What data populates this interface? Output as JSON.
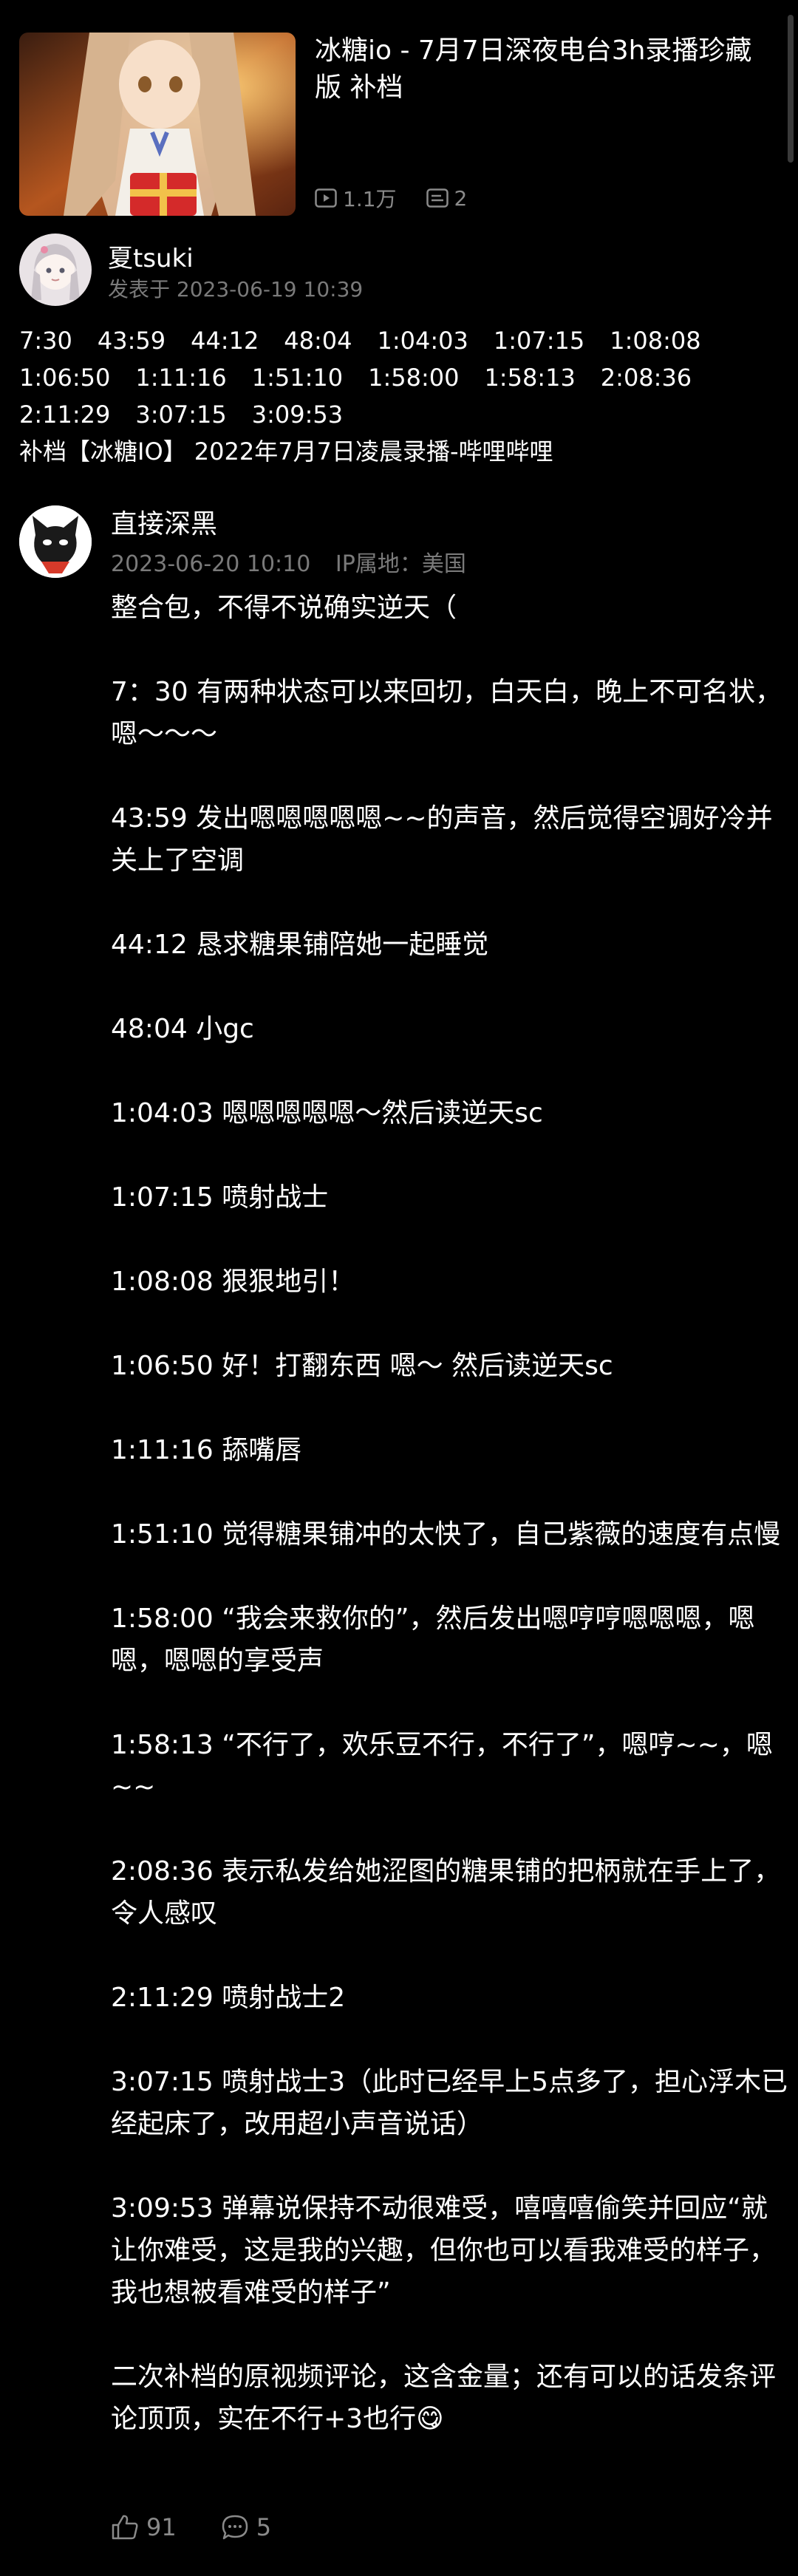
{
  "video": {
    "title": "冰糖io - 7月7日深夜电台3h录播珍藏版 补档",
    "views": "1.1万",
    "comments": "2",
    "thumbnail_icon": "anime-girl-thumbnail"
  },
  "post": {
    "author": "夏tsuki",
    "posted_at": "发表于 2023-06-19 10:39",
    "timestamps": [
      "7:30",
      "43:59",
      "44:12",
      "48:04",
      "1:04:03",
      "1:07:15",
      "1:08:08",
      "1:06:50",
      "1:11:16",
      "1:51:10",
      "1:58:00",
      "1:58:13",
      "2:08:36",
      "2:11:29",
      "3:07:15",
      "3:09:53"
    ],
    "link_text": "补档【冰糖IO】 2022年7月7日凌晨录播-哔哩哔哩"
  },
  "comment": {
    "author": "直接深黑",
    "date": "2023-06-20 10:10",
    "ip_location": "IP属地：美国",
    "paragraphs": [
      "整合包，不得不说确实逆天（",
      "7：30 有两种状态可以来回切，白天白，晚上不可名状，嗯～～～",
      "43:59 发出嗯嗯嗯嗯嗯~~的声音，然后觉得空调好冷并关上了空调",
      "44:12 恳求糖果铺陪她一起睡觉",
      "48:04  小gc",
      "1:04:03 嗯嗯嗯嗯嗯～然后读逆天sc",
      "1:07:15 喷射战士",
      "1:08:08 狠狠地引！",
      "1:06:50 好！打翻东西 嗯～ 然后读逆天sc",
      "1:11:16 舔嘴唇",
      "1:51:10 觉得糖果铺冲的太快了，自己紫薇的速度有点慢",
      "1:58:00 “我会来救你的”，然后发出嗯哼哼嗯嗯嗯，嗯嗯，嗯嗯的享受声",
      "1:58:13 “不行了，欢乐豆不行，不行了”，嗯哼~~，嗯~~",
      "2:08:36 表示私发给她涩图的糖果铺的把柄就在手上了，令人感叹",
      "2:11:29 喷射战士2",
      "3:07:15 喷射战士3（此时已经早上5点多了，担心浮木已经起床了，改用超小声音说话）",
      "3:09:53 弹幕说保持不动很难受，嘻嘻嘻偷笑并回应“就让你难受，这是我的兴趣，但你也可以看我难受的样子，我也想被看难受的样子”",
      "二次补档的原视频评论，这含金量；还有可以的话发条评论顶顶，实在不行+3也行😋"
    ],
    "likes": "91",
    "replies": "5"
  },
  "colors": {
    "background": "#000000",
    "text_primary": "#ffffff",
    "text_secondary": "#7a7a7a"
  }
}
